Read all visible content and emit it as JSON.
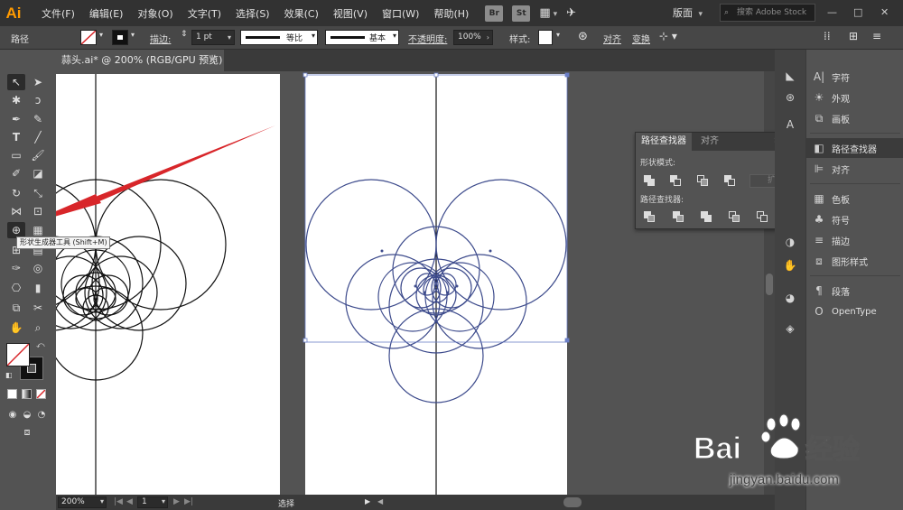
{
  "app": {
    "logo": "Ai"
  },
  "menu": [
    "文件(F)",
    "编辑(E)",
    "对象(O)",
    "文字(T)",
    "选择(S)",
    "效果(C)",
    "视图(V)",
    "窗口(W)",
    "帮助(H)"
  ],
  "menu_badges": [
    "Br",
    "St"
  ],
  "workspace_label": "版面",
  "stock_search": {
    "placeholder": "搜索 Adobe Stock"
  },
  "control_bar": {
    "object_type": "路径",
    "stroke_label": "描边",
    "stroke_weight": "1 pt",
    "profile_label": "等比",
    "brush_label": "基本",
    "opacity_label": "不透明度",
    "opacity_value": "100%",
    "style_label": "样式",
    "align_label": "对齐",
    "transform_label": "变换"
  },
  "document_tab": {
    "title": "蒜头.ai* @ 200% (RGB/GPU 预览)"
  },
  "toolbar": {
    "tooltip": "形状生成器工具 (Shift+M)",
    "selected_tool": "shape-builder"
  },
  "pathfinder_panel": {
    "tabs": [
      "路径查找器",
      "对齐"
    ],
    "active_tab": "路径查找器",
    "shape_modes_label": "形状模式",
    "expand_label": "扩展",
    "pathfinders_label": "路径查找器"
  },
  "right_dock": {
    "items": [
      {
        "icon": "character-icon",
        "label": "字符"
      },
      {
        "icon": "appearance-icon",
        "label": "外观"
      },
      {
        "icon": "artboards-icon",
        "label": "画板"
      },
      {
        "icon": "pathfinder-icon",
        "label": "路径查找器",
        "active": true
      },
      {
        "icon": "align-icon",
        "label": "对齐"
      },
      {
        "icon": "swatches-icon",
        "label": "色板"
      },
      {
        "icon": "symbols-icon",
        "label": "符号"
      },
      {
        "icon": "stroke-icon",
        "label": "描边"
      },
      {
        "icon": "graphic-styles-icon",
        "label": "图形样式"
      },
      {
        "icon": "paragraph-icon",
        "label": "段落"
      },
      {
        "icon": "opentype-icon",
        "label": "OpenType"
      }
    ]
  },
  "status_bar": {
    "zoom": "200%",
    "artboard_number": "1",
    "mode": "选择"
  },
  "watermark": {
    "logo_text": "Bai",
    "logo_suffix": "经验",
    "url": "jingyan.baidu.com"
  },
  "colors": {
    "accent_orange": "#ff9a00",
    "selection_blue": "#3d4b8c",
    "annotation_red": "#d8262a",
    "artwork_black": "#111111"
  }
}
